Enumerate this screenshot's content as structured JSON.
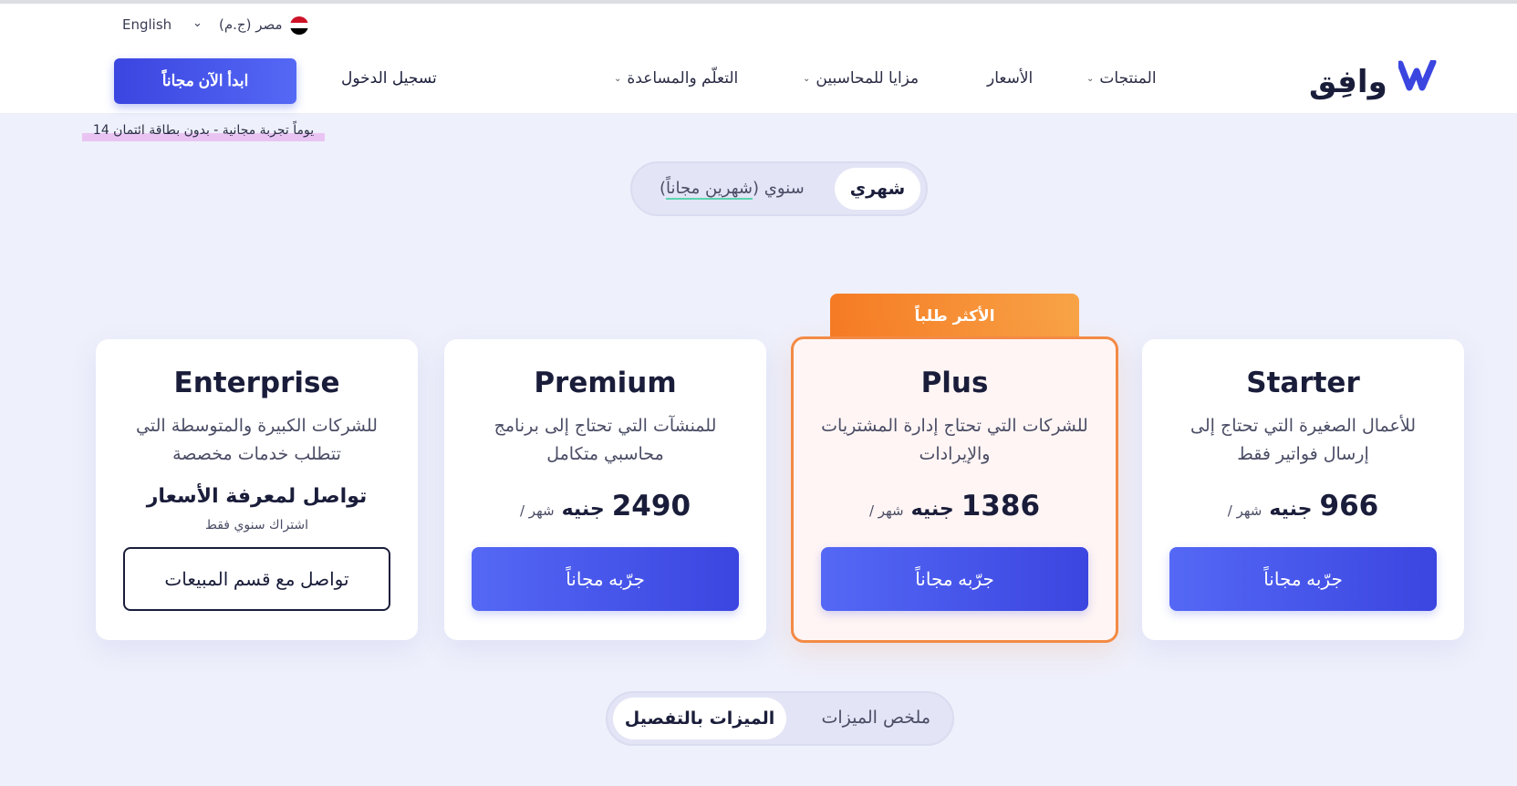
{
  "header": {
    "logo_text": "وافِق",
    "nav": [
      "المنتجات",
      "الأسعار",
      "مزايا للمحاسبين",
      "التعلّم والمساعدة"
    ],
    "language": "English",
    "country": "مصر (ج.م)",
    "login_label": "تسجيل الدخول",
    "cta_label": "ابدأ الآن مجاناً",
    "trial_note": "14 يوماً تجربة مجانية - بدون بطاقة ائتمان"
  },
  "billing": {
    "monthly": "شهري",
    "annual_prefix": "سنوي (",
    "annual_free": "شهرين مجاناً",
    "annual_suffix": ")"
  },
  "badge": "الأكثر طلباً",
  "plans": [
    {
      "name": "Starter",
      "desc": "للأعمال الصغيرة التي تحتاج إلى إرسال فواتير فقط",
      "amount": "966",
      "currency": "جنيه",
      "per": "/ شهر",
      "button": "جرّبه مجاناً"
    },
    {
      "name": "Plus",
      "desc": "للشركات التي تحتاج إدارة المشتريات والإيرادات",
      "amount": "1386",
      "currency": "جنيه",
      "per": "/ شهر",
      "button": "جرّبه مجاناً"
    },
    {
      "name": "Premium",
      "desc": "للمنشآت التي تحتاج إلى برنامج محاسبي متكامل",
      "amount": "2490",
      "currency": "جنيه",
      "per": "/ شهر",
      "button": "جرّبه مجاناً"
    },
    {
      "name": "Enterprise",
      "desc": "للشركات الكبيرة والمتوسطة التي تتطلب خدمات مخصصة",
      "contact_title": "تواصل لمعرفة الأسعار",
      "contact_sub": "اشتراك سنوي فقط",
      "button": "تواصل مع قسم المبيعات"
    }
  ],
  "features_toggle": {
    "detailed": "الميزات بالتفصيل",
    "summary": "ملخص الميزات"
  },
  "colors": {
    "primary": "#3b45e0",
    "accent_orange": "#f57b24",
    "background": "#eef0fb"
  }
}
